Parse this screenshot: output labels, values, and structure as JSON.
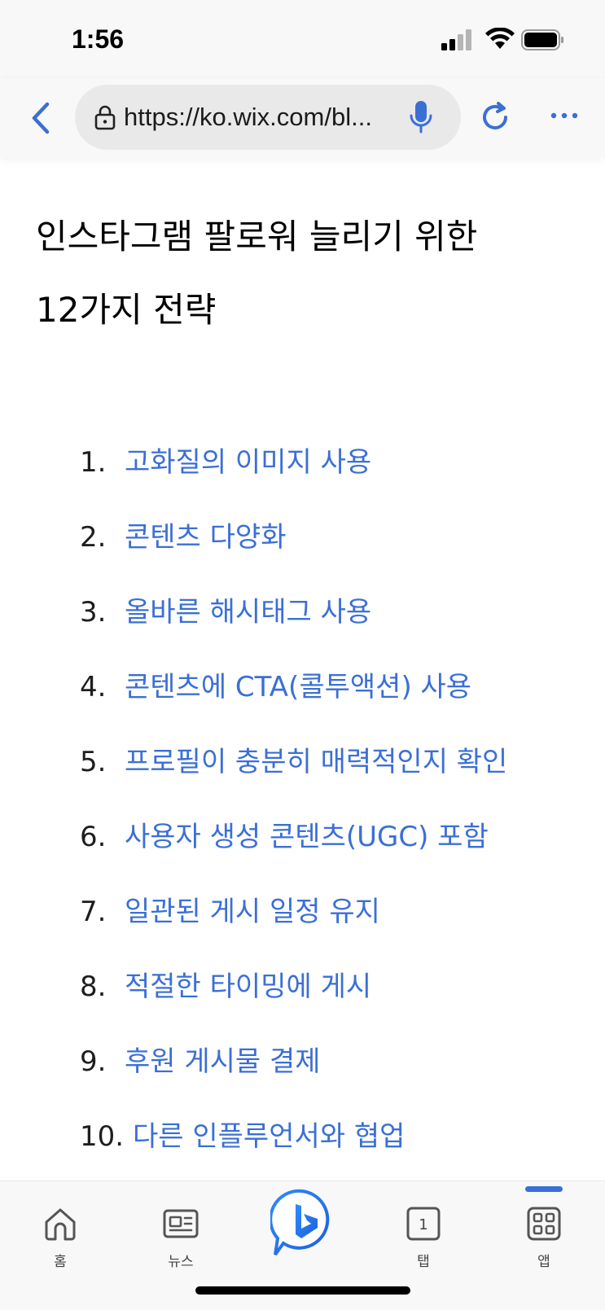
{
  "status_bar": {
    "time": "1:56"
  },
  "browser": {
    "url": "https://ko.wix.com/bl...",
    "icons": [
      "back-icon",
      "lock-icon",
      "mic-icon",
      "refresh-icon",
      "more-icon"
    ]
  },
  "article": {
    "title_line1": "인스타그램 팔로워 늘리기 위한",
    "title_line2": "12가지 전략",
    "toc": [
      {
        "num": "1.",
        "text": "고화질의 이미지 사용"
      },
      {
        "num": "2.",
        "text": "콘텐츠 다양화"
      },
      {
        "num": "3.",
        "text": "올바른 해시태그 사용"
      },
      {
        "num": "4.",
        "text": "콘텐츠에 CTA(콜투액션) 사용"
      },
      {
        "num": "5.",
        "text": "프로필이 충분히 매력적인지 확인"
      },
      {
        "num": "6.",
        "text": "사용자 생성 콘텐츠(UGC) 포함"
      },
      {
        "num": "7.",
        "text": "일관된 게시 일정 유지"
      },
      {
        "num": "8.",
        "text": "적절한 타이밍에 게시"
      },
      {
        "num": "9.",
        "text": "후원 게시물 결제"
      },
      {
        "num": "10.",
        "text": "다른 인플루언서와 협업"
      }
    ]
  },
  "bottom_nav": {
    "home": "홈",
    "news": "뉴스",
    "tabs": "탭",
    "tabs_count": "1",
    "apps": "앱"
  },
  "colors": {
    "link": "#3b6fd6",
    "accent": "#3b6fd6",
    "toolbar_bg": "#f8f8f8"
  }
}
